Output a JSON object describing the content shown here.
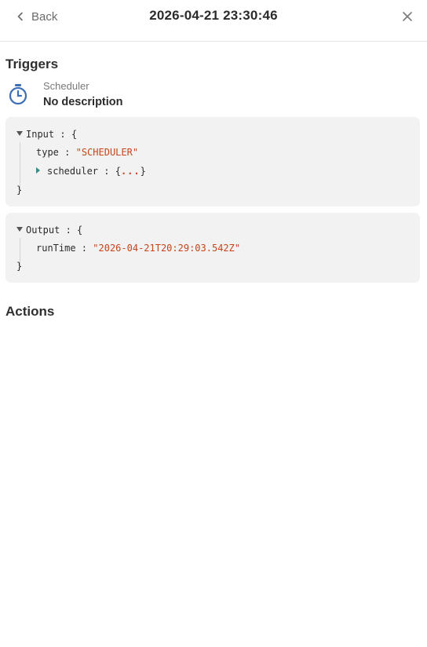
{
  "header": {
    "back_label": "Back",
    "title": "2026-04-21 23:30:46"
  },
  "triggers": {
    "section_title": "Triggers",
    "item": {
      "icon": "timer-icon",
      "type_label": "Scheduler",
      "description": "No description"
    },
    "input": {
      "key": "Input",
      "open_brace": "{",
      "close_brace": "}",
      "fields": [
        {
          "key": "type",
          "value": "\"SCHEDULER\""
        },
        {
          "key": "scheduler",
          "value_open": "{",
          "value_ellipsis": "...",
          "value_close": "}"
        }
      ]
    },
    "output": {
      "key": "Output",
      "open_brace": "{",
      "close_brace": "}",
      "fields": [
        {
          "key": "runTime",
          "value": "\"2026-04-21T20:29:03.542Z\""
        }
      ]
    }
  },
  "actions": {
    "section_title": "Actions"
  },
  "colors": {
    "string_value": "#c4451c",
    "icon_accent": "#3f6fb5",
    "box_bg": "#f2f2f2"
  }
}
